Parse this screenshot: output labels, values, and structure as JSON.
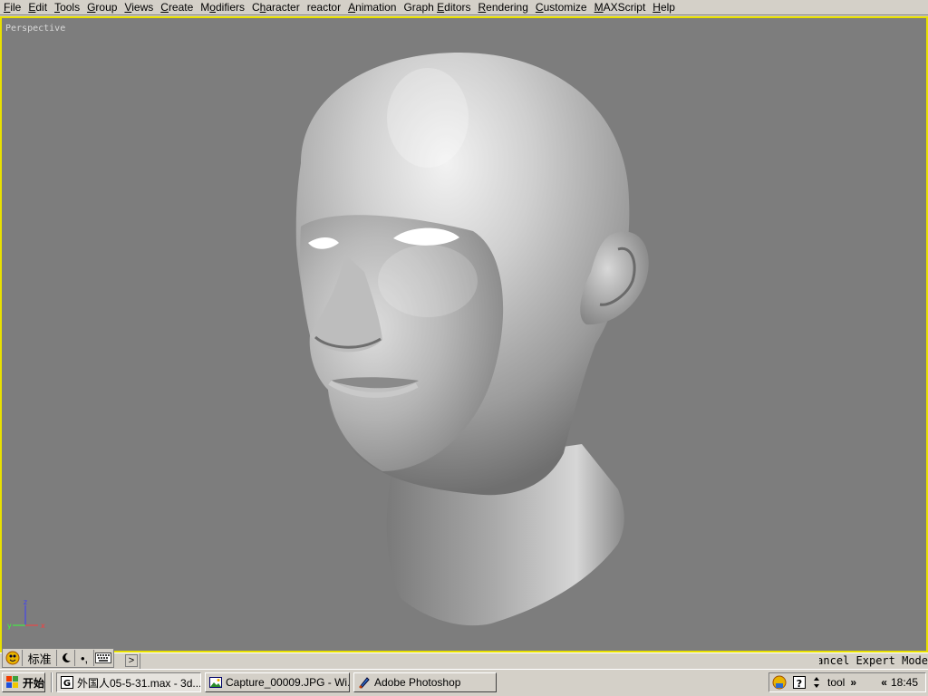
{
  "menu": {
    "items": [
      {
        "id": "file",
        "accel": "F",
        "rest": "ile"
      },
      {
        "id": "edit",
        "accel": "E",
        "rest": "dit"
      },
      {
        "id": "tools",
        "accel": "T",
        "rest": "ools"
      },
      {
        "id": "group",
        "accel": "G",
        "rest": "roup"
      },
      {
        "id": "views",
        "accel": "V",
        "rest": "iews"
      },
      {
        "id": "create",
        "accel": "C",
        "rest": "reate"
      },
      {
        "id": "modifiers",
        "accel": "",
        "pre": "M",
        "accel2": "o",
        "rest": "difiers"
      },
      {
        "id": "character",
        "accel": "",
        "pre": "C",
        "accel2": "h",
        "rest": "aracter"
      },
      {
        "id": "reactor",
        "accel": "",
        "pre": "reactor",
        "accel2": "",
        "rest": ""
      },
      {
        "id": "animation",
        "accel": "A",
        "rest": "nimation"
      },
      {
        "id": "graph-editors",
        "accel": "",
        "pre": "Graph ",
        "accel2": "E",
        "rest": "ditors"
      },
      {
        "id": "rendering",
        "accel": "R",
        "rest": "endering"
      },
      {
        "id": "customize",
        "accel": "C",
        "rest": "ustomize"
      },
      {
        "id": "maxscript",
        "accel": "M",
        "rest": "AXScript"
      },
      {
        "id": "help",
        "accel": "H",
        "rest": "elp"
      }
    ]
  },
  "viewport": {
    "label": "Perspective",
    "border_color": "#e8e000",
    "background": "#7d7d7d",
    "axis": {
      "x": "x",
      "y": "y",
      "z": "z"
    }
  },
  "status": {
    "ime": {
      "logo_icon": "ime-logo-icon",
      "mode": "标准",
      "moon_icon": "half-width-moon-icon",
      "punct": "•,",
      "keyboard_icon": "soft-keyboard-icon"
    },
    "arrow": ">",
    "expert_mode": "Cancel Expert Mode"
  },
  "taskbar": {
    "start_label": "开始",
    "tasks": [
      {
        "label": "外国人05-5-31.max - 3d...",
        "icon": "3dsmax-icon",
        "active": true
      },
      {
        "label": "Capture_00009.JPG - Wi...",
        "icon": "image-viewer-icon",
        "active": false
      },
      {
        "label": "Adobe Photoshop",
        "icon": "photoshop-icon",
        "active": false
      }
    ],
    "tray": {
      "tool": "tool",
      "chevron": "»",
      "back": "«",
      "clock": "18:45"
    }
  }
}
